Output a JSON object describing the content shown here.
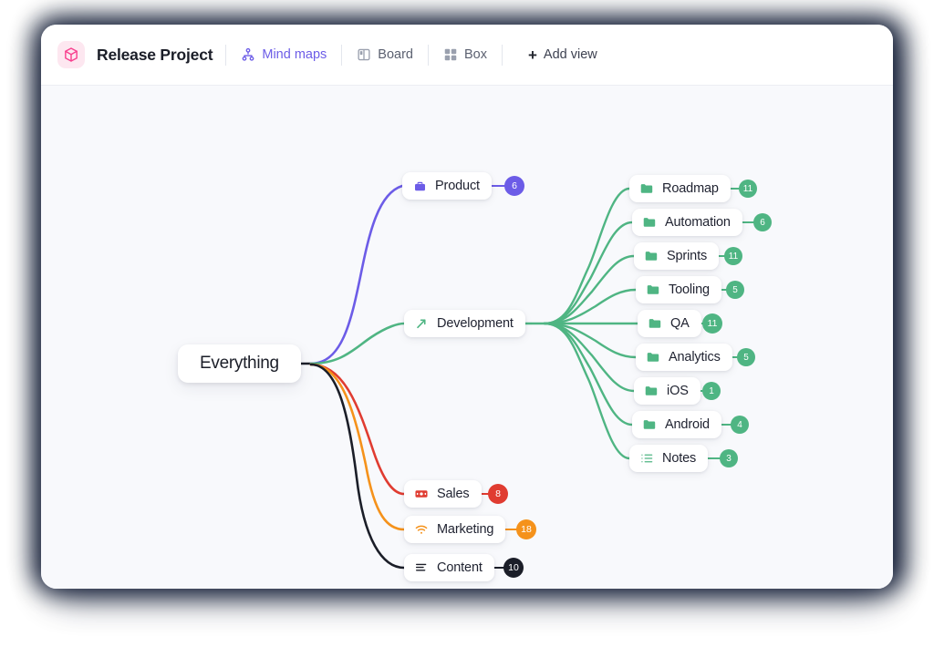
{
  "window": {
    "logo_icon": "cube-icon",
    "app_title": "Release Project"
  },
  "header": {
    "views": [
      {
        "label": "Mind maps",
        "icon": "sitemap-icon",
        "active": true
      },
      {
        "label": "Board",
        "icon": "board-icon",
        "active": false
      },
      {
        "label": "Box",
        "icon": "grid-icon",
        "active": false
      }
    ],
    "add_view_label": "Add view",
    "add_view_icon": "plus-icon"
  },
  "colors": {
    "accent_purple": "#6c5ce7",
    "accent_green": "#4fb583",
    "accent_red": "#e03c31",
    "accent_orange": "#f5921b",
    "accent_black": "#1b1e28",
    "logo_pink": "#f8418f",
    "canvas_bg": "#f8f9fc"
  },
  "mindmap": {
    "root": {
      "label": "Everything",
      "icon": "none"
    },
    "branches": [
      {
        "label": "Product",
        "icon": "briefcase-icon",
        "count": "6",
        "color": "#6c5ce7"
      },
      {
        "label": "Development",
        "icon": "trending-up-icon",
        "count": "",
        "color": "#4fb583"
      },
      {
        "label": "Sales",
        "icon": "money-icon",
        "count": "8",
        "color": "#e03c31"
      },
      {
        "label": "Marketing",
        "icon": "wifi-icon",
        "count": "18",
        "color": "#f5921b"
      },
      {
        "label": "Content",
        "icon": "text-lines-icon",
        "count": "10",
        "color": "#1b1e28"
      }
    ],
    "development_children": [
      {
        "label": "Roadmap",
        "icon": "folder-icon",
        "count": "11",
        "color": "#4fb583"
      },
      {
        "label": "Automation",
        "icon": "folder-icon",
        "count": "6",
        "color": "#4fb583"
      },
      {
        "label": "Sprints",
        "icon": "folder-icon",
        "count": "11",
        "color": "#4fb583"
      },
      {
        "label": "Tooling",
        "icon": "folder-icon",
        "count": "5",
        "color": "#4fb583"
      },
      {
        "label": "QA",
        "icon": "folder-icon",
        "count": "11",
        "color": "#4fb583"
      },
      {
        "label": "Analytics",
        "icon": "folder-icon",
        "count": "5",
        "color": "#4fb583"
      },
      {
        "label": "iOS",
        "icon": "folder-icon",
        "count": "1",
        "color": "#4fb583"
      },
      {
        "label": "Android",
        "icon": "folder-icon",
        "count": "4",
        "color": "#4fb583"
      },
      {
        "label": "Notes",
        "icon": "list-icon",
        "count": "3",
        "color": "#4fb583"
      }
    ]
  }
}
